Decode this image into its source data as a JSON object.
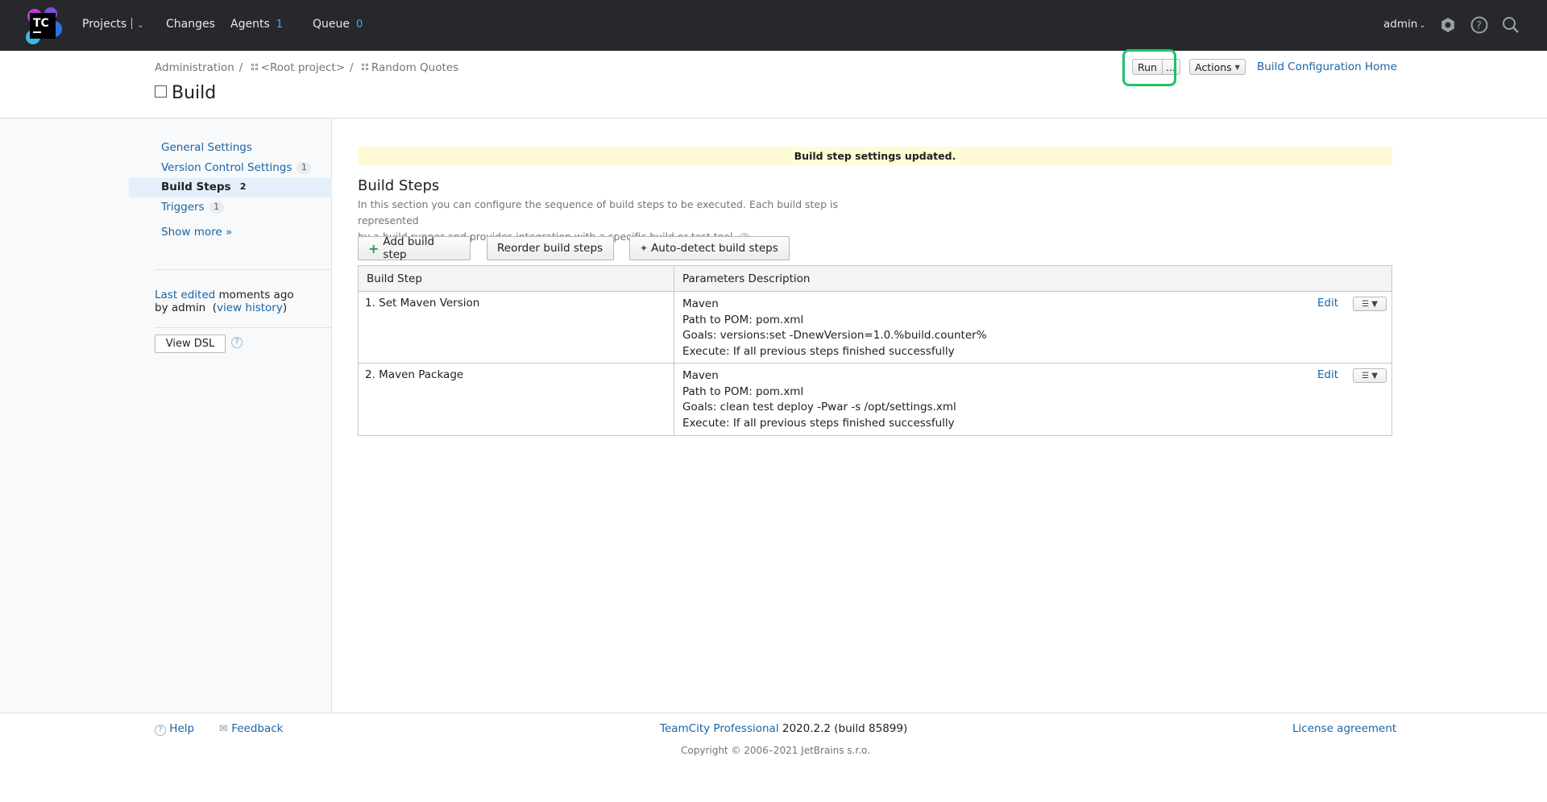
{
  "header": {
    "logo_text": "TC",
    "projects_label": "Projects",
    "changes_label": "Changes",
    "agents_label": "Agents",
    "agents_count": "1",
    "queue_label": "Queue",
    "queue_count": "0",
    "user_label": "admin"
  },
  "breadcrumb": {
    "admin": "Administration",
    "root": "<Root project>",
    "project": "Random Quotes"
  },
  "title": "Build",
  "toolbar": {
    "run_label": "Run",
    "run_more_label": "...",
    "actions_label": "Actions",
    "home_link": "Build Configuration Home",
    "highlight_color": "#21c06a"
  },
  "sidebar": {
    "items": [
      {
        "label": "General Settings",
        "count": ""
      },
      {
        "label": "Version Control Settings",
        "count": "1"
      },
      {
        "label": "Build Steps",
        "count": "2"
      },
      {
        "label": "Triggers",
        "count": "1"
      }
    ],
    "show_more": "Show more »",
    "last_edited_link": "Last edited",
    "last_edited_when": "moments ago",
    "by_user": "by admin",
    "view_history": "view history",
    "view_dsl": "View DSL"
  },
  "notice": "Build step settings updated.",
  "section": {
    "title": "Build Steps",
    "desc_line1": "In this section you can configure the sequence of build steps to be executed. Each build step is represented",
    "desc_line2": "by a build runner and provides integration with a specific build or test tool."
  },
  "buttons": {
    "add": "Add build step",
    "reorder": "Reorder build steps",
    "autodetect": "Auto-detect build steps"
  },
  "table": {
    "headers": [
      "Build Step",
      "Parameters Description"
    ],
    "edit_label": "Edit",
    "rows": [
      {
        "name": "1. Set Maven Version",
        "lines": [
          "Maven",
          "Path to POM: pom.xml",
          "Goals: versions:set -DnewVersion=1.0.%build.counter%",
          "Execute: If all previous steps finished successfully"
        ]
      },
      {
        "name": "2. Maven Package",
        "lines": [
          "Maven",
          "Path to POM: pom.xml",
          "Goals: clean test deploy -Pwar -s /opt/settings.xml",
          "Execute: If all previous steps finished successfully"
        ]
      }
    ]
  },
  "footer": {
    "help": "Help",
    "feedback": "Feedback",
    "product": "TeamCity Professional",
    "version": "2020.2.2 (build 85899)",
    "license": "License agreement",
    "copyright": "Copyright © 2006–2021 JetBrains s.r.o."
  }
}
